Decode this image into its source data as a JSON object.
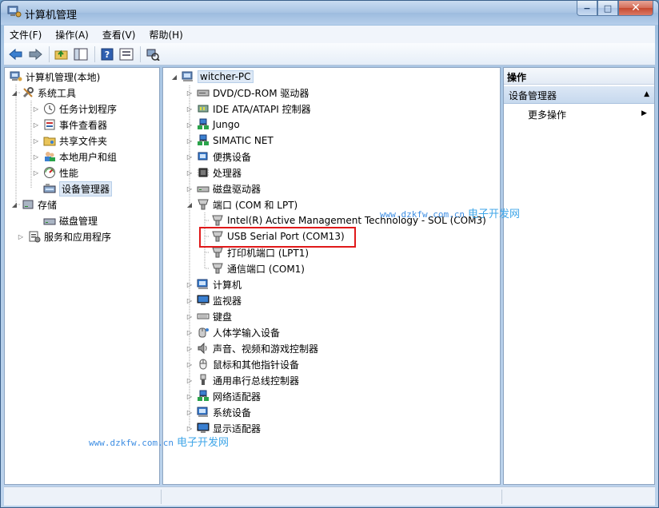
{
  "window": {
    "title": "计算机管理",
    "min_glyph": "−",
    "max_glyph": "□",
    "close_glyph": "✕"
  },
  "menu": [
    "文件(F)",
    "操作(A)",
    "查看(V)",
    "帮助(H)"
  ],
  "toolbar": [
    "back-arrow-icon",
    "forward-arrow-icon",
    "up-folder-icon",
    "show-hide-tree-icon",
    "help-icon",
    "properties-icon",
    "scan-hardware-icon"
  ],
  "left_tree": {
    "root": "计算机管理(本地)",
    "system_tools": "系统工具",
    "task_scheduler": "任务计划程序",
    "event_viewer": "事件查看器",
    "shared_folders": "共享文件夹",
    "local_users": "本地用户和组",
    "performance": "性能",
    "device_manager": "设备管理器",
    "storage": "存储",
    "disk_management": "磁盘管理",
    "services_apps": "服务和应用程序"
  },
  "device_tree": {
    "root": "witcher-PC",
    "categories": [
      "DVD/CD-ROM 驱动器",
      "IDE ATA/ATAPI 控制器",
      "Jungo",
      "SIMATIC NET",
      "便携设备",
      "处理器",
      "磁盘驱动器",
      "端口 (COM 和 LPT)"
    ],
    "ports": [
      "Intel(R) Active Management Technology - SOL (COM3)",
      "USB Serial Port (COM13)",
      "打印机端口 (LPT1)",
      "通信端口 (COM1)"
    ],
    "categories_after": [
      "计算机",
      "监视器",
      "键盘",
      "人体学输入设备",
      "声音、视频和游戏控制器",
      "鼠标和其他指针设备",
      "通用串行总线控制器",
      "网络适配器",
      "系统设备",
      "显示适配器"
    ]
  },
  "actions": {
    "header": "操作",
    "section": "设备管理器",
    "more": "更多操作"
  },
  "watermarks": {
    "url": "www.dzkfw.com.cn",
    "name": "电子开发网"
  },
  "colors": {
    "highlight_box": "#e0191a",
    "watermark": "#3e8ee3"
  }
}
